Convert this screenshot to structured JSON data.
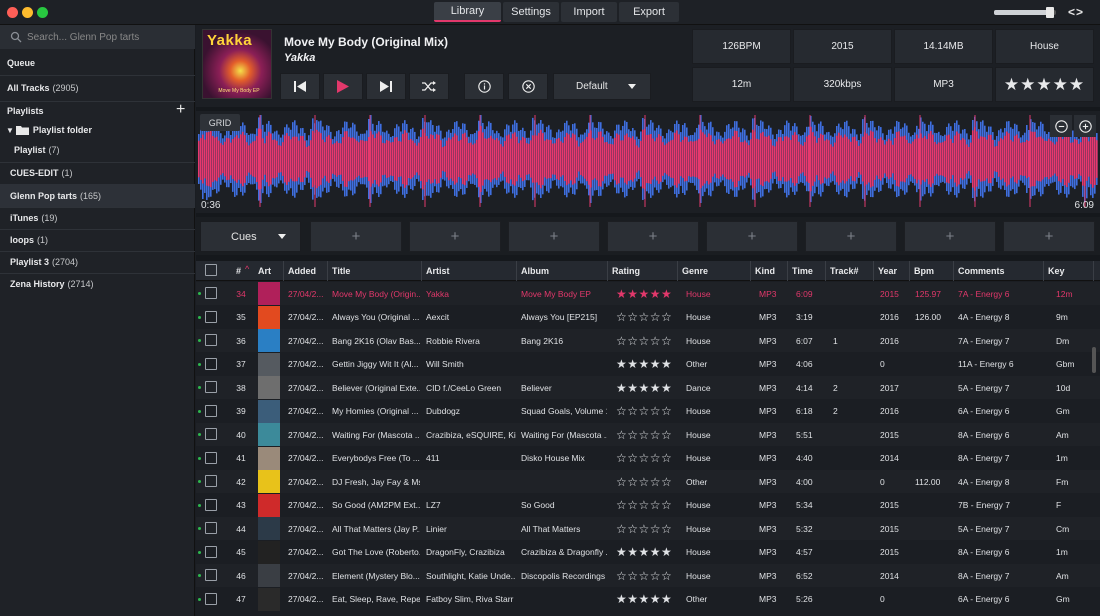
{
  "tabs": [
    "Library",
    "Settings",
    "Import",
    "Export"
  ],
  "nav_arrows": "<>",
  "volume_level": 0.9,
  "search": {
    "placeholder": "Search... Glenn Pop tarts"
  },
  "sidebar": {
    "queue": "Queue",
    "all_tracks": {
      "label": "All Tracks",
      "count": "(2905)"
    },
    "playlists_header": "Playlists",
    "add_label": "+",
    "folder": "Playlist folder",
    "items": [
      {
        "label": "Playlist",
        "count": "(7)"
      },
      {
        "label": "CUES-EDIT",
        "count": "(1)"
      },
      {
        "label": "Glenn Pop tarts",
        "count": "(165)"
      },
      {
        "label": "iTunes",
        "count": "(19)"
      },
      {
        "label": "loops",
        "count": "(1)"
      },
      {
        "label": "Playlist 3",
        "count": "(2704)"
      },
      {
        "label": "Zena History",
        "count": "(2714)"
      }
    ]
  },
  "deck": {
    "art_title": "Yakka",
    "art_sub": "Move My Body EP",
    "title": "Move My Body (Original Mix)",
    "artist": "Yakka",
    "default_label": "Default",
    "stats": [
      "126BPM",
      "2015",
      "14.14MB",
      "House",
      "12m",
      "320kbps",
      "MP3",
      "★★★★★"
    ]
  },
  "wave": {
    "grid_label": "GRID",
    "time_start": "0:36",
    "time_end": "6:09",
    "colors": {
      "pink": "#e8386e",
      "blue": "#3f6fe0"
    }
  },
  "cues": {
    "label": "Cues",
    "slot": "+"
  },
  "table": {
    "headers": [
      "#",
      "Art",
      "Added",
      "Title",
      "Artist",
      "Album",
      "Rating",
      "Genre",
      "Kind",
      "Time",
      "Track#",
      "Year",
      "Bpm",
      "Comments",
      "Key"
    ],
    "rows": [
      {
        "n": "34",
        "added": "27/04/2...",
        "title": "Move My Body (Origin...",
        "artist": "Yakka",
        "album": "Move My Body EP",
        "rating": "★★★★★",
        "genre": "House",
        "kind": "MP3",
        "time": "6:09",
        "track": "",
        "year": "2015",
        "bpm": "125.97",
        "comments": "7A - Energy 6",
        "key": "12m",
        "hl": true,
        "art": "#b0205a"
      },
      {
        "n": "35",
        "added": "27/04/2...",
        "title": "Always You (Original ...",
        "artist": "Aexcit",
        "album": "Always You [EP215]",
        "rating": "☆☆☆☆☆",
        "genre": "House",
        "kind": "MP3",
        "time": "3:19",
        "track": "",
        "year": "2016",
        "bpm": "126.00",
        "comments": "4A - Energy 8",
        "key": "9m",
        "art": "#e24a1f"
      },
      {
        "n": "36",
        "added": "27/04/2...",
        "title": "Bang 2K16 (Olav Bas...",
        "artist": "Robbie Rivera",
        "album": "Bang 2K16",
        "rating": "☆☆☆☆☆",
        "genre": "House",
        "kind": "MP3",
        "time": "6:07",
        "track": "1",
        "year": "2016",
        "bpm": "",
        "comments": "7A - Energy 7",
        "key": "Dm",
        "art": "#2a7fc4"
      },
      {
        "n": "37",
        "added": "27/04/2...",
        "title": "Gettin Jiggy Wit It (Al...",
        "artist": "Will Smith",
        "album": "",
        "rating": "★★★★★",
        "genre": "Other",
        "kind": "MP3",
        "time": "4:06",
        "track": "",
        "year": "0",
        "bpm": "",
        "comments": "11A - Energy 6",
        "key": "Gbm",
        "art": "#555a60"
      },
      {
        "n": "38",
        "added": "27/04/2...",
        "title": "Believer (Original Exte...",
        "artist": "CID f./CeeLo Green",
        "album": "Believer",
        "rating": "★★★★★",
        "genre": "Dance",
        "kind": "MP3",
        "time": "4:14",
        "track": "2",
        "year": "2017",
        "bpm": "",
        "comments": "5A - Energy 7",
        "key": "10d",
        "art": "#6e6e6e"
      },
      {
        "n": "39",
        "added": "27/04/2...",
        "title": "My Homies (Original ...",
        "artist": "Dubdogz",
        "album": "Squad Goals, Volume 1",
        "rating": "☆☆☆☆☆",
        "genre": "House",
        "kind": "MP3",
        "time": "6:18",
        "track": "2",
        "year": "2016",
        "bpm": "",
        "comments": "6A - Energy 6",
        "key": "Gm",
        "art": "#3b5d7a"
      },
      {
        "n": "40",
        "added": "27/04/2...",
        "title": "Waiting For (Mascota ...",
        "artist": "Crazibiza, eSQUIRE, Ki...",
        "album": "Waiting For (Mascota ...",
        "rating": "☆☆☆☆☆",
        "genre": "House",
        "kind": "MP3",
        "time": "5:51",
        "track": "",
        "year": "2015",
        "bpm": "",
        "comments": "8A - Energy 6",
        "key": "Am",
        "art": "#3c8a9a"
      },
      {
        "n": "41",
        "added": "27/04/2...",
        "title": "Everybodys Free (To ...",
        "artist": "411",
        "album": "Disko House Mix",
        "rating": "☆☆☆☆☆",
        "genre": "House",
        "kind": "MP3",
        "time": "4:40",
        "track": "",
        "year": "2014",
        "bpm": "",
        "comments": "8A - Energy 7",
        "key": "1m",
        "art": "#9a8a7a"
      },
      {
        "n": "42",
        "added": "27/04/2...",
        "title": "DJ Fresh, Jay Fay & Ms...",
        "artist": "",
        "album": "",
        "rating": "☆☆☆☆☆",
        "genre": "Other",
        "kind": "MP3",
        "time": "4:00",
        "track": "",
        "year": "0",
        "bpm": "112.00",
        "comments": "4A - Energy 8",
        "key": "Fm",
        "art": "#e8c21a"
      },
      {
        "n": "43",
        "added": "27/04/2...",
        "title": "So Good (AM2PM Ext...",
        "artist": "LZ7",
        "album": "So Good",
        "rating": "☆☆☆☆☆",
        "genre": "House",
        "kind": "MP3",
        "time": "5:34",
        "track": "",
        "year": "2015",
        "bpm": "",
        "comments": "7B - Energy 7",
        "key": "F",
        "art": "#cf2a2a"
      },
      {
        "n": "44",
        "added": "27/04/2...",
        "title": "All That Matters (Jay P...",
        "artist": "Linier",
        "album": "All That Matters",
        "rating": "☆☆☆☆☆",
        "genre": "House",
        "kind": "MP3",
        "time": "5:32",
        "track": "",
        "year": "2015",
        "bpm": "",
        "comments": "5A - Energy 7",
        "key": "Cm",
        "art": "#2c3a48"
      },
      {
        "n": "45",
        "added": "27/04/2...",
        "title": "Got The Love (Roberto...",
        "artist": "DragonFly, Crazibiza",
        "album": "Crazibiza & Dragonfly ...",
        "rating": "★★★★★",
        "genre": "House",
        "kind": "MP3",
        "time": "4:57",
        "track": "",
        "year": "2015",
        "bpm": "",
        "comments": "8A - Energy 6",
        "key": "1m",
        "art": "#222"
      },
      {
        "n": "46",
        "added": "27/04/2...",
        "title": "Element (Mystery Blo...",
        "artist": "Southlight, Katie Unde...",
        "album": "Discopolis Recordings",
        "rating": "☆☆☆☆☆",
        "genre": "House",
        "kind": "MP3",
        "time": "6:52",
        "track": "",
        "year": "2014",
        "bpm": "",
        "comments": "8A - Energy 7",
        "key": "Am",
        "art": "#3a3e44"
      },
      {
        "n": "47",
        "added": "27/04/2...",
        "title": "Eat, Sleep, Rave, Repe...",
        "artist": "Fatboy Slim, Riva Starr",
        "album": "",
        "rating": "★★★★★",
        "genre": "Other",
        "kind": "MP3",
        "time": "5:26",
        "track": "",
        "year": "0",
        "bpm": "",
        "comments": "6A - Energy 6",
        "key": "Gm",
        "art": "#2a2a2a"
      }
    ]
  }
}
